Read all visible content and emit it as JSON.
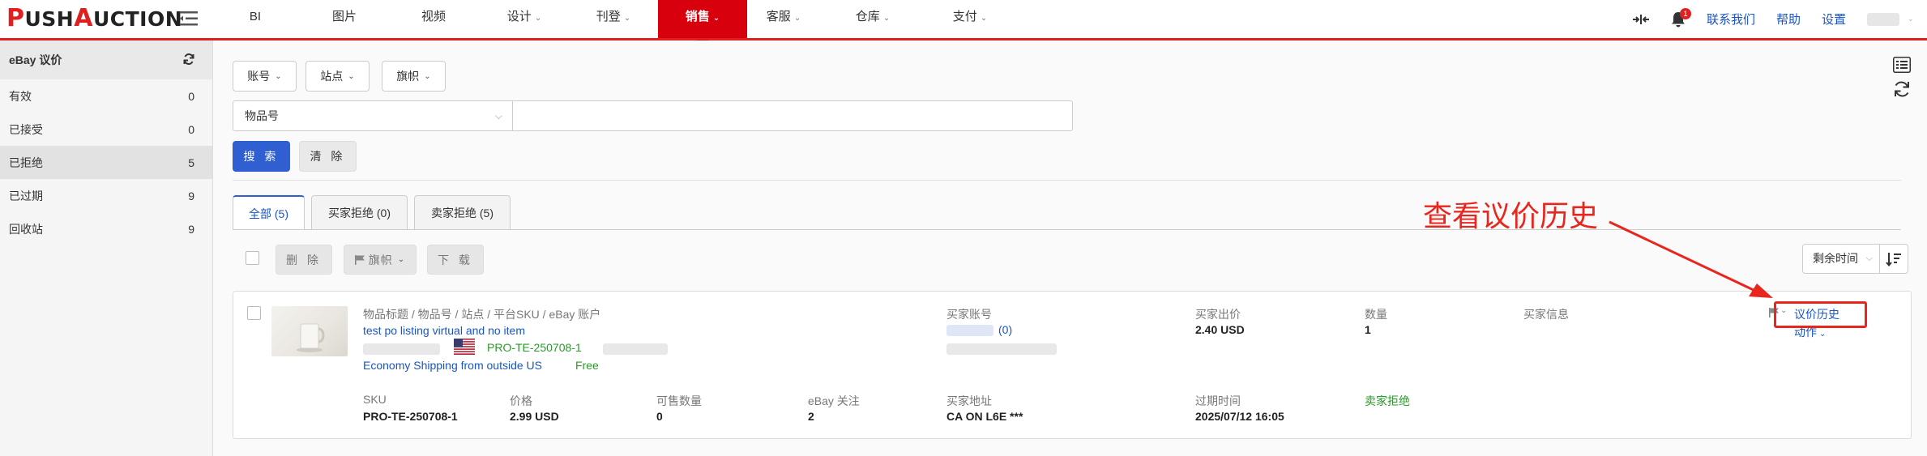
{
  "logo": {
    "p": "P",
    "ush": "USH",
    "a": "A",
    "uction": "UCTION"
  },
  "nav": {
    "items": [
      {
        "label": "BI",
        "caret": ""
      },
      {
        "label": "图片",
        "caret": ""
      },
      {
        "label": "视频",
        "caret": ""
      },
      {
        "label": "设计",
        "caret": "⌄"
      },
      {
        "label": "刊登",
        "caret": "⌄"
      },
      {
        "label": "销售",
        "caret": "⌄"
      },
      {
        "label": "客服",
        "caret": "⌄"
      },
      {
        "label": "仓库",
        "caret": "⌄"
      },
      {
        "label": "支付",
        "caret": "⌄"
      }
    ],
    "active_index": 5,
    "notification_count": "1",
    "links": {
      "contact": "联系我们",
      "help": "帮助",
      "settings": "设置"
    }
  },
  "sidebar": {
    "title": "eBay 议价",
    "items": [
      {
        "label": "有效",
        "count": "0"
      },
      {
        "label": "已接受",
        "count": "0"
      },
      {
        "label": "已拒绝",
        "count": "5"
      },
      {
        "label": "已过期",
        "count": "9"
      },
      {
        "label": "回收站",
        "count": "9"
      }
    ],
    "active_index": 2
  },
  "filters": {
    "account": "账号",
    "site": "站点",
    "flag": "旗帜",
    "field_select": "物品号",
    "search": "搜 索",
    "clear": "清 除"
  },
  "tabs": [
    {
      "label": "全部 (5)"
    },
    {
      "label": "买家拒绝 (0)"
    },
    {
      "label": "卖家拒绝 (5)"
    }
  ],
  "bulk": {
    "delete": "删 除",
    "flag": "旗帜",
    "download": "下 载",
    "sort": "剩余时间"
  },
  "offer": {
    "title_header": "物品标题 / 物品号 / 站点 / 平台SKU / eBay 账户",
    "title": "test po listing virtual and no item",
    "platform_sku": "PRO-TE-250708-1",
    "shipping": "Economy Shipping from outside US",
    "shipping_cost": "Free",
    "buyer_account_label": "买家账号",
    "buyer_feedback": "(0)",
    "buyer_offer_label": "买家出价",
    "buyer_offer": "2.40 USD",
    "quantity_label": "数量",
    "quantity": "1",
    "buyer_info_label": "买家信息",
    "history_link": "议价历史",
    "action_link": "动作",
    "sku_label": "SKU",
    "sku": "PRO-TE-250708-1",
    "price_label": "价格",
    "price": "2.99 USD",
    "available_label": "可售数量",
    "available": "0",
    "watchers_label": "eBay 关注",
    "watchers": "2",
    "address_label": "买家地址",
    "address": "CA ON L6E ***",
    "expire_label": "过期时间",
    "expire": "2025/07/12 16:05",
    "status": "卖家拒绝"
  },
  "annotation": {
    "text": "查看议价历史",
    "color": "#e8261e"
  },
  "colors": {
    "brand_red": "#d9000d",
    "link_blue": "#1a55c4",
    "primary": "#2f5fd0",
    "status_green": "#2a9a2a"
  }
}
